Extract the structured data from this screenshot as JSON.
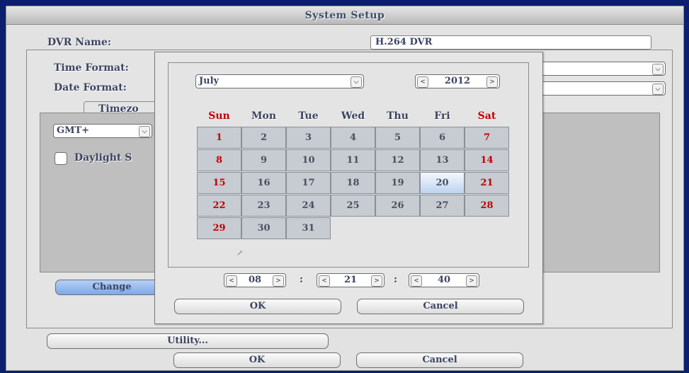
{
  "window": {
    "title": "System Setup"
  },
  "dvr_name": {
    "label": "DVR Name:",
    "value": "H.264 DVR"
  },
  "time_format": {
    "label": "Time Format:"
  },
  "date_format": {
    "label": "Date Format:"
  },
  "timezone": {
    "tab_label": "Timezo",
    "value": "GMT+",
    "daylight_label": "Daylight S"
  },
  "change_button": "Change",
  "utility_button": "Utility...",
  "ok_button": "OK",
  "cancel_button": "Cancel",
  "calendar": {
    "month": "July",
    "year": "2012",
    "weekdays": [
      "Sun",
      "Mon",
      "Tue",
      "Wed",
      "Thu",
      "Fri",
      "Sat"
    ],
    "days": [
      [
        "1",
        "2",
        "3",
        "4",
        "5",
        "6",
        "7"
      ],
      [
        "8",
        "9",
        "10",
        "11",
        "12",
        "13",
        "14"
      ],
      [
        "15",
        "16",
        "17",
        "18",
        "19",
        "20",
        "21"
      ],
      [
        "22",
        "23",
        "24",
        "25",
        "26",
        "27",
        "28"
      ],
      [
        "29",
        "30",
        "31"
      ]
    ],
    "selected_day": "20",
    "hour": "08",
    "minute": "21",
    "second": "40",
    "time_separator": ":",
    "ok_button": "OK",
    "cancel_button": "Cancel"
  },
  "colors": {
    "weekend": "#c00000",
    "cell": "#c7cbd2",
    "selected": "#bcd4f0",
    "change_button": "#8fb6ec"
  }
}
